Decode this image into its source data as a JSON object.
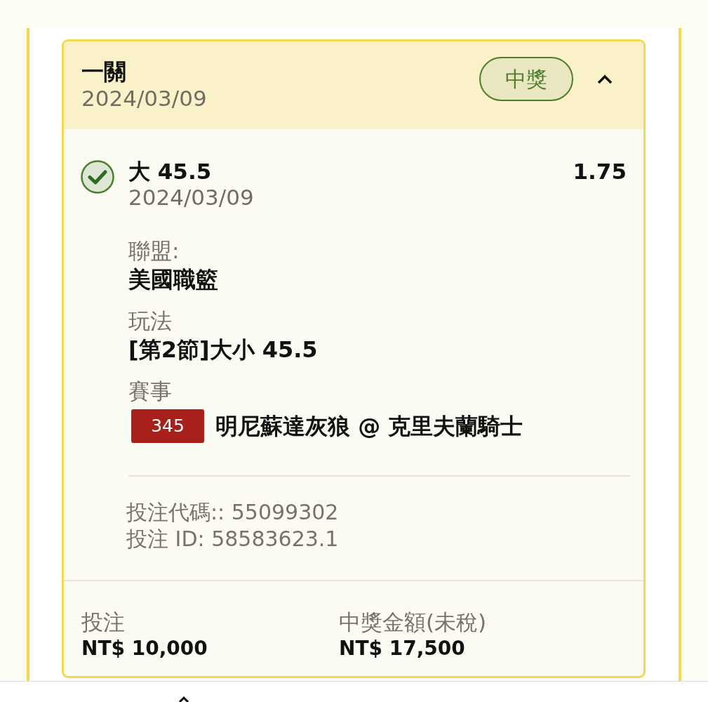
{
  "bet_card": {
    "title": "一關",
    "date": "2024/03/09",
    "status_badge": {
      "text": "中獎",
      "kind": "won"
    },
    "expanded": true,
    "selection": {
      "won": true,
      "name": "大 45.5",
      "odds": "1.75",
      "date": "2024/03/09"
    },
    "details": [
      {
        "label": "聯盟:",
        "value": "美國職籃"
      },
      {
        "label": "玩法",
        "value": "[第2節]大小 45.5"
      },
      {
        "label": "賽事",
        "event_number": "345",
        "value": "明尼蘇達灰狼 @ 克里夫蘭騎士"
      }
    ],
    "references": [
      "投注代碼:: 55099302",
      "投注 ID: 58583623.1"
    ],
    "totals": [
      {
        "label": "投注",
        "value": "NT$ 10,000"
      },
      {
        "label": "中獎金額(未稅)",
        "value": "NT$ 17,500"
      }
    ]
  }
}
